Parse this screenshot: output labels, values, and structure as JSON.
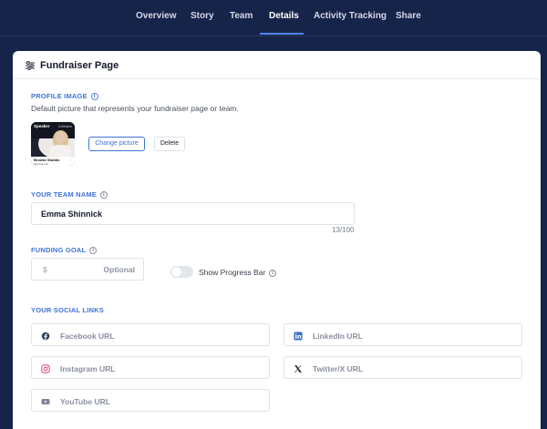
{
  "nav": {
    "tabs": [
      {
        "label": "Overview"
      },
      {
        "label": "Story"
      },
      {
        "label": "Team"
      },
      {
        "label": "Details"
      },
      {
        "label": "Activity Tracking"
      },
      {
        "label": "Share"
      }
    ],
    "active": "Details"
  },
  "panel": {
    "title": "Fundraiser Page"
  },
  "profile": {
    "label": "PROFILE IMAGE",
    "description": "Default picture that represents your fundraiser page or team.",
    "thumb": {
      "heading": "Speaker",
      "tag": "Collective",
      "name": "Brooke Stubbs",
      "role": "Motivational"
    },
    "change_label": "Change picture",
    "delete_label": "Delete"
  },
  "team": {
    "label": "YOUR TEAM NAME",
    "value": "Emma Shinnick",
    "counter": "13/100"
  },
  "goal": {
    "label": "FUNDING GOAL",
    "currency": "$",
    "placeholder": "Optional",
    "toggle_label": "Show Progress Bar",
    "toggle_on": false
  },
  "social": {
    "label": "YOUR SOCIAL LINKS",
    "facebook": "Facebook URL",
    "linkedin": "LinkedIn URL",
    "instagram": "Instagram URL",
    "twitter": "Twitter/X URL",
    "youtube": "YouTube URL"
  },
  "colors": {
    "background": "#17244a",
    "accent": "#3f73d8",
    "nav_underline": "#4d86ee"
  }
}
